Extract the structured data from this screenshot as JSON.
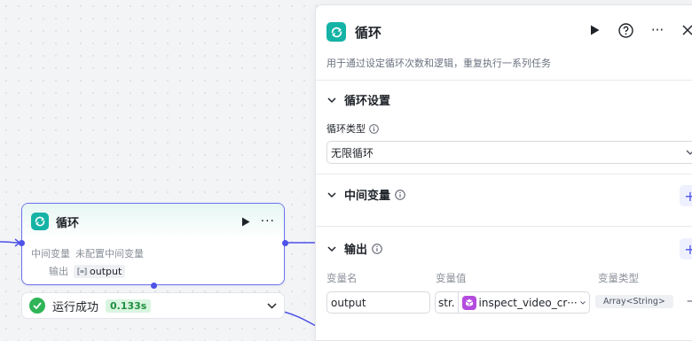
{
  "node": {
    "title": "循环",
    "row1_label": "中间变量",
    "row1_value": "未配置中间变量",
    "row2_label": "输出",
    "output_tag": "output"
  },
  "status": {
    "text": "运行成功",
    "time": "0.133s"
  },
  "panel": {
    "title": "循环",
    "description": "用于通过设定循环次数和逻辑，重复执行一系列任务",
    "sections": {
      "settings": "循环设置",
      "variables": "中间变量",
      "output": "输出"
    },
    "loop_type_label": "循环类型",
    "loop_type_value": "无限循环",
    "columns": {
      "name": "变量名",
      "value": "变量值",
      "type": "变量类型"
    },
    "output_row": {
      "name": "output",
      "prefix": "str.",
      "ref": "inspect_video_cr···",
      "type": "Array<String>"
    }
  },
  "colors": {
    "accent": "#4d53e8",
    "loop_icon": "#15b3a6",
    "success": "#2fb457"
  }
}
